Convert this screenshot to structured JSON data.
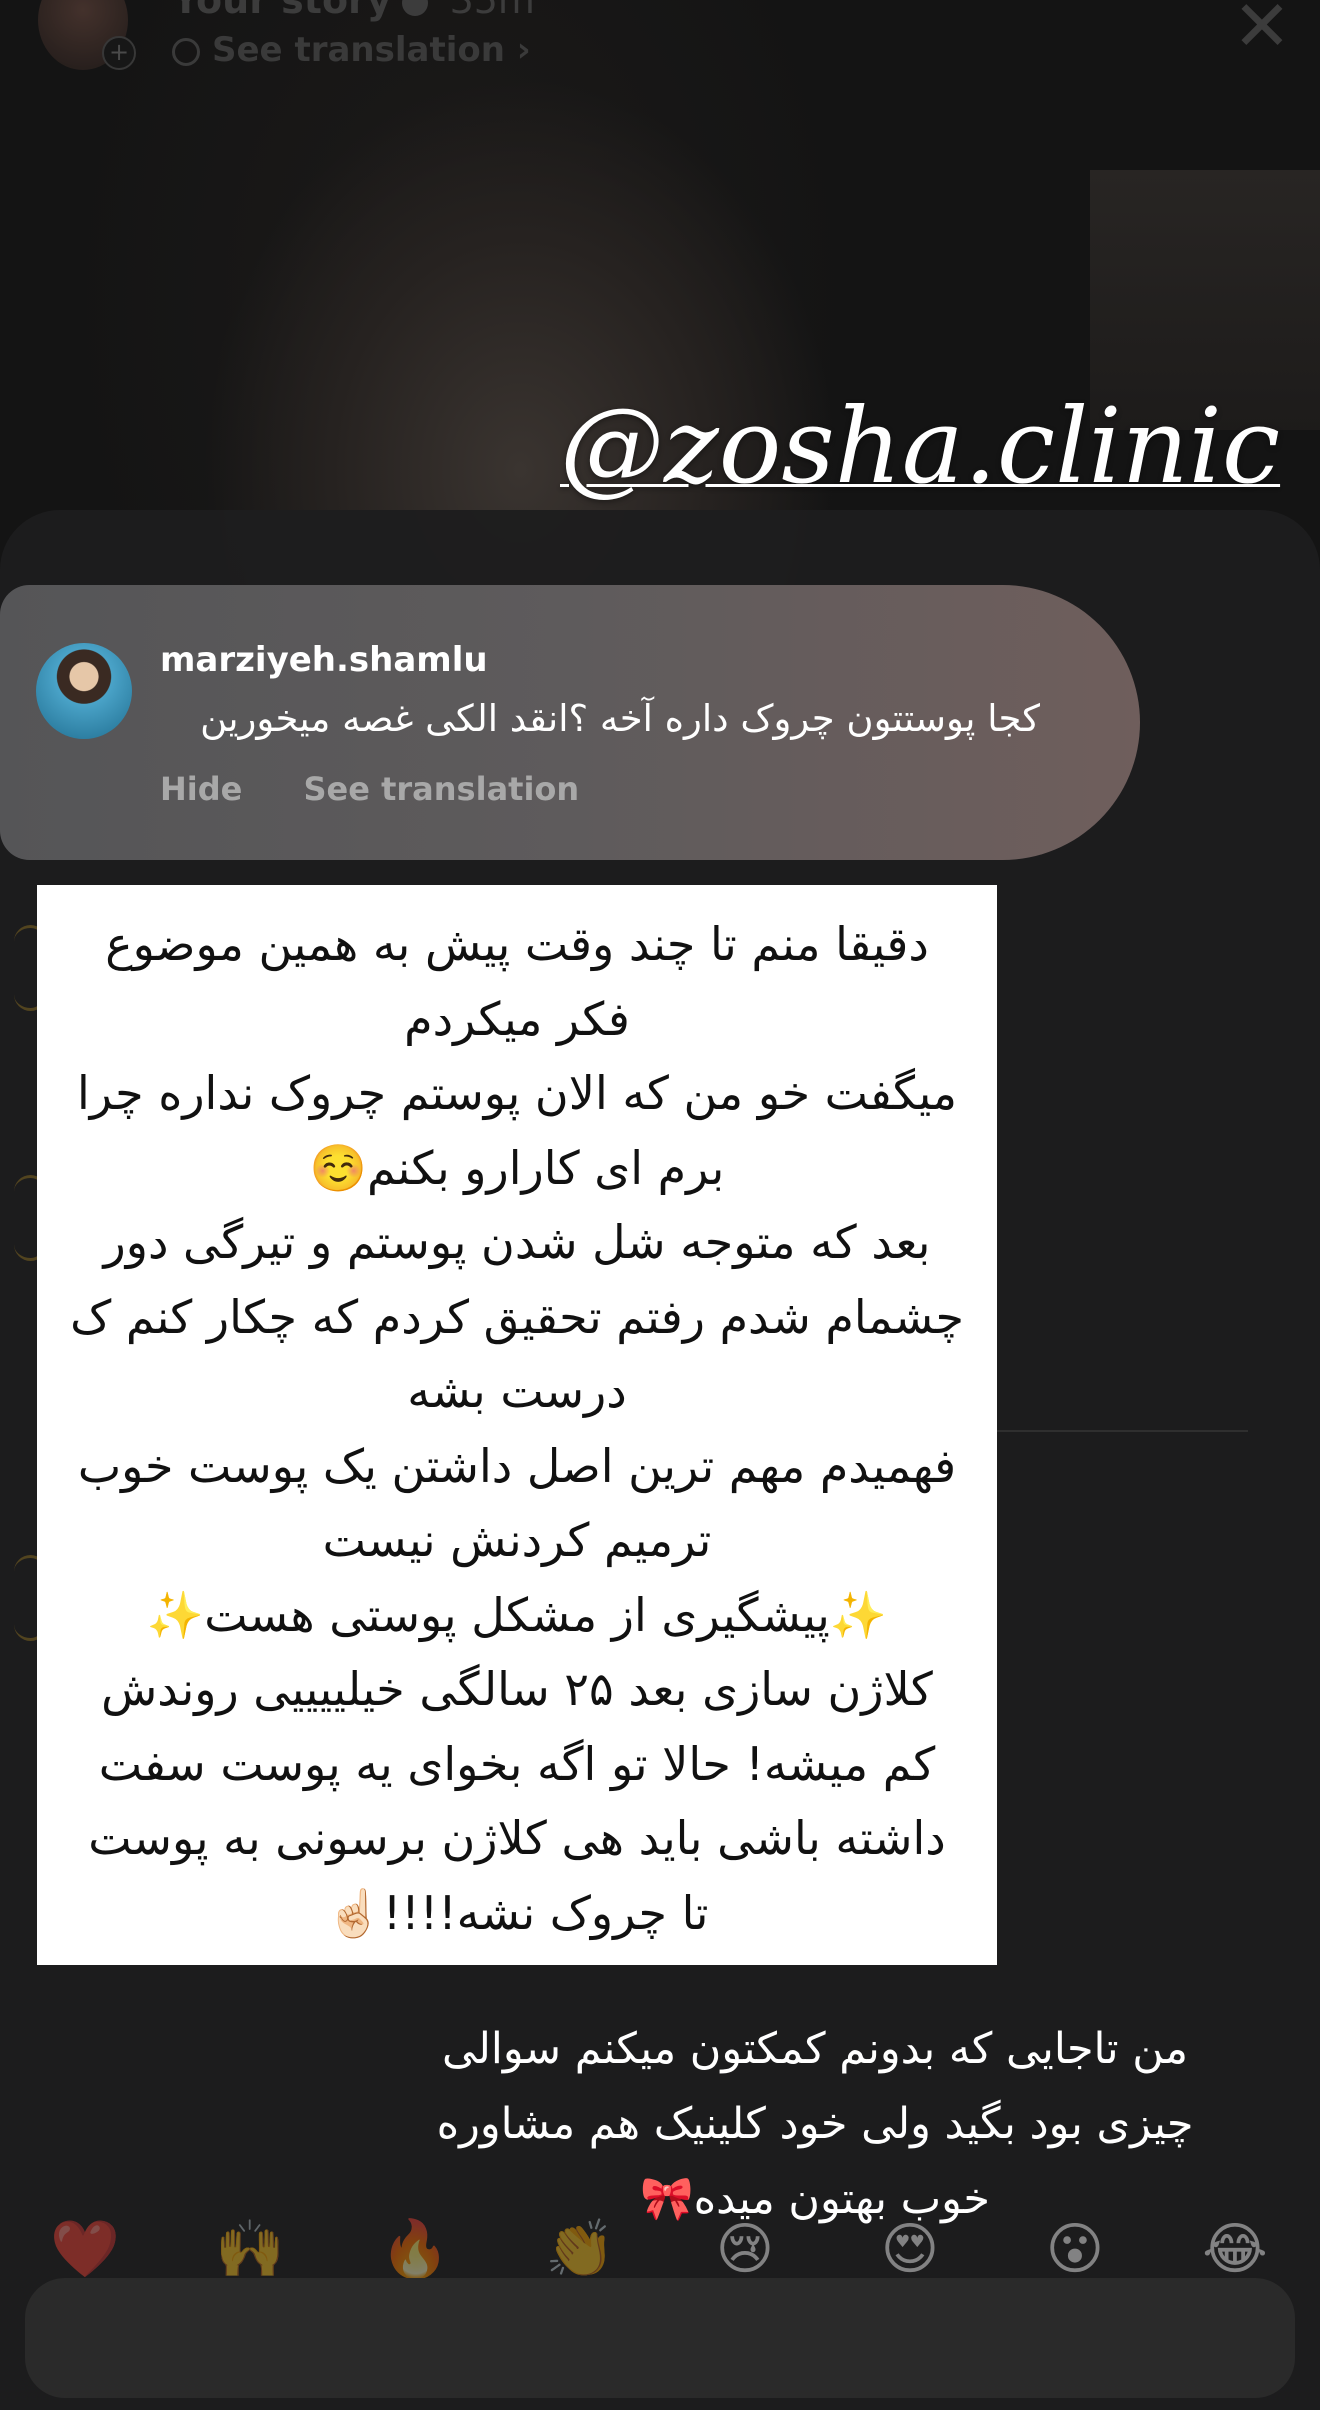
{
  "story_header": {
    "title": "Your story",
    "time": "35m",
    "translate_label": "See translation",
    "translate_chevron": "›",
    "close_glyph": "✕"
  },
  "story_overlay": {
    "handle": "@zosha.clinic"
  },
  "comment": {
    "username": "marziyeh.shamlu",
    "text": "کجا پوستتون چروک داره آخه ؟انقد الکی غصه میخورین",
    "hide_label": "Hide",
    "translate_label": "See translation"
  },
  "reply_card": {
    "lines": [
      "دقیقا منم تا چند وقت پیش به همین موضوع",
      "فکر میکردم",
      "میگفت خو من که الان پوستم چروک نداره چرا",
      "برم ای کارارو بکنم☺️",
      "بعد که متوجه شل شدن پوستم و تیرگی دور",
      "چشمام شدم رفتم تحقیق کردم که چکار کنم ک",
      "درست بشه",
      "فهمیدم مهم ترین اصل داشتن یک پوست خوب",
      "ترمیم کردنش نیست",
      "✨پیشگیری از مشکل پوستی هست✨",
      "کلاژن سازی بعد ۲۵ سالگی خیلییییی روندش",
      "کم میشه! حالا تو اگه بخوای یه پوست سفت",
      "داشته باشی باید هی کلاژن برسونی به پوست",
      "تا چروک نشه!!!!☝🏻"
    ]
  },
  "caption": {
    "lines": [
      "من تاجایی که بدونم کمکتون میکنم سوالی",
      "چیزی بود بگید ولی خود کلینیک هم مشاوره",
      "خوب بهتون میده🎀"
    ]
  },
  "reactions": [
    "❤️",
    "🙌",
    "🔥",
    "👏",
    "😢",
    "😍",
    "😮",
    "😂"
  ],
  "icons": {
    "close": "close-icon",
    "verified": "verified-badge-icon",
    "globe": "globe-icon",
    "add": "plus-icon"
  }
}
